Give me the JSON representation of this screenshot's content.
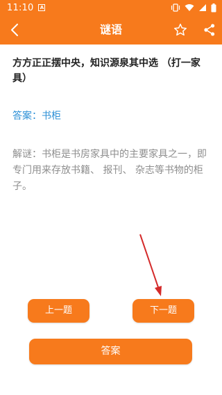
{
  "status_bar": {
    "time": "11:10",
    "notification_icon": "A"
  },
  "app_bar": {
    "title": "谜语",
    "back_icon": "chevron-left-icon",
    "favorite_icon": "star-outline-icon",
    "share_icon": "share-icon"
  },
  "riddle": {
    "question": "方方正正摆中央，知识源泉其中选 （打一家具）",
    "answer": "答案：书柜",
    "explanation": "解谜：书柜是书房家具中的主要家具之一，即专门用来存放书籍、 报刊、 杂志等书物的柜子。"
  },
  "buttons": {
    "prev_label": "上一题",
    "next_label": "下一题",
    "answer_label": "答案"
  },
  "colors": {
    "accent": "#f77a1c",
    "answer_text": "#2b8fd6",
    "annotation_arrow": "#d42a2a"
  }
}
